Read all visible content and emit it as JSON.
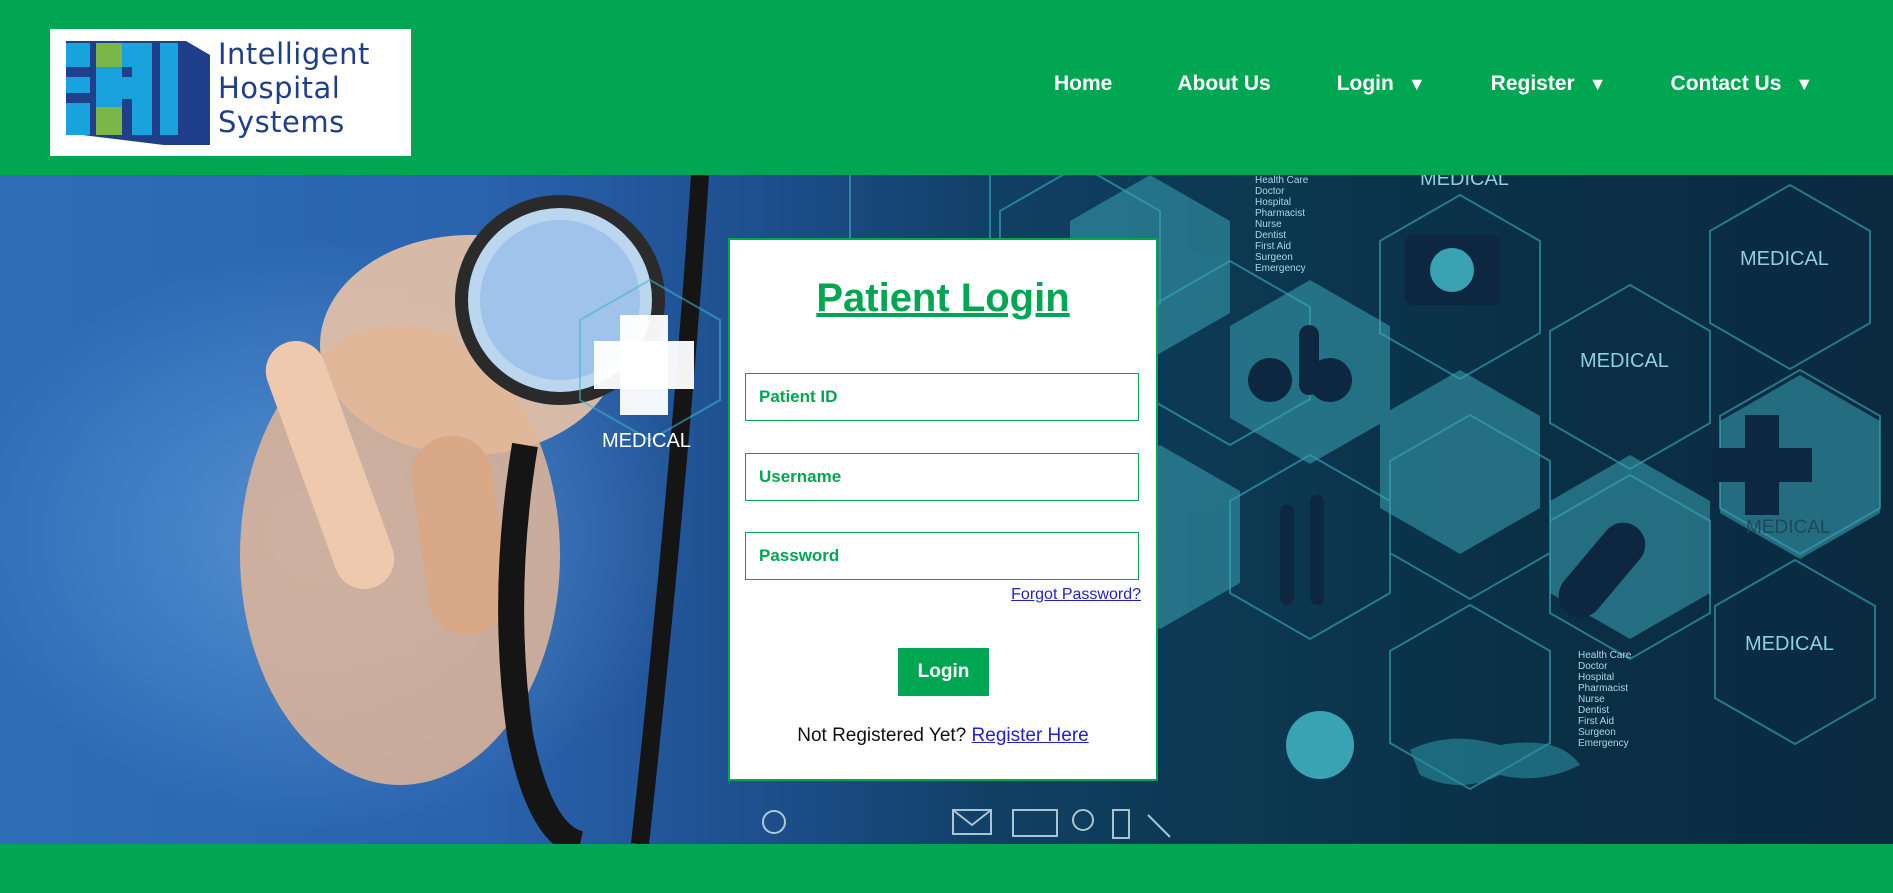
{
  "brand": {
    "logo_lines": [
      "Intelligent",
      "Hospital",
      "Systems"
    ],
    "primary_color": "#00a651",
    "logo_text_color": "#1f3f8a"
  },
  "nav": {
    "home": "Home",
    "about": "About Us",
    "login": "Login",
    "register": "Register",
    "contact": "Contact Us",
    "caret": "▼"
  },
  "hero": {
    "labels": [
      "MEDICAL",
      "MEDICAL",
      "MEDICAL",
      "MEDICAL",
      "MEDICAL",
      "MEDICAL"
    ],
    "staff_list": [
      "Health Care",
      "Doctor",
      "Hospital",
      "Pharmacist",
      "Nurse",
      "Dentist",
      "First Aid",
      "Surgeon",
      "Emergency"
    ]
  },
  "login_card": {
    "title": "Patient Login",
    "patient_id_placeholder": "Patient ID",
    "username_placeholder": "Username",
    "password_placeholder": "Password",
    "forgot_password": "Forgot Password?",
    "login_button": "Login",
    "not_registered": "Not Registered Yet?",
    "register_link": "Register Here"
  }
}
